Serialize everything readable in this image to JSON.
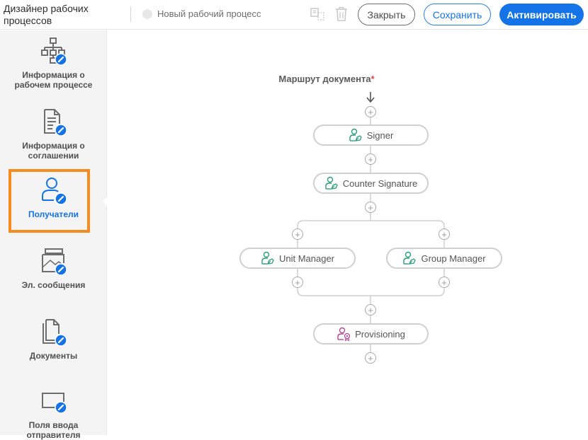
{
  "header": {
    "app_title": "Дизайнер рабочих процессов",
    "workflow_name": "Новый рабочий процесс",
    "buttons": {
      "close": "Закрыть",
      "save": "Сохранить",
      "activate": "Активировать"
    },
    "icons": [
      "duplicate-icon",
      "trash-icon"
    ]
  },
  "sidebar": {
    "items": [
      {
        "label": "Информация о рабочем процессе",
        "icon": "workflow-info-icon",
        "active": false
      },
      {
        "label": "Информация о соглашении",
        "icon": "agreement-info-icon",
        "active": false
      },
      {
        "label": "Получатели",
        "icon": "recipients-icon",
        "active": true
      },
      {
        "label": "Эл. сообщения",
        "icon": "emails-icon",
        "active": false
      },
      {
        "label": "Документы",
        "icon": "documents-icon",
        "active": false
      },
      {
        "label": "Поля ввода отправителя",
        "icon": "sender-fields-icon",
        "active": false
      }
    ]
  },
  "route": {
    "title": "Маршрут документа",
    "required_mark": "*",
    "nodes": {
      "signer": "Signer",
      "counter_signature": "Counter Signature",
      "unit_manager": "Unit Manager",
      "group_manager": "Group Manager",
      "provisioning": "Provisioning"
    },
    "colors": {
      "signer_icon": "#2d9d78",
      "provisioning_icon": "#b5479b",
      "accent": "#1473e6",
      "highlight": "#f68b1f"
    }
  }
}
